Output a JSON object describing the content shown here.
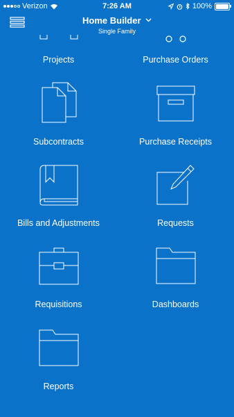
{
  "status_bar": {
    "carrier": "Verizon",
    "time": "7:26 AM",
    "battery": "100%"
  },
  "header": {
    "title": "Home Builder",
    "subtitle": "Single Family"
  },
  "tiles": [
    {
      "label": "Projects",
      "icon": "projects-icon"
    },
    {
      "label": "Purchase Orders",
      "icon": "purchase-orders-icon"
    },
    {
      "label": "Subcontracts",
      "icon": "documents-icon"
    },
    {
      "label": "Purchase Receipts",
      "icon": "archive-box-icon"
    },
    {
      "label": "Bills and Adjustments",
      "icon": "book-icon"
    },
    {
      "label": "Requests",
      "icon": "edit-icon"
    },
    {
      "label": "Requisitions",
      "icon": "briefcase-icon"
    },
    {
      "label": "Dashboards",
      "icon": "folder-icon"
    },
    {
      "label": "Reports",
      "icon": "folder-icon"
    }
  ]
}
